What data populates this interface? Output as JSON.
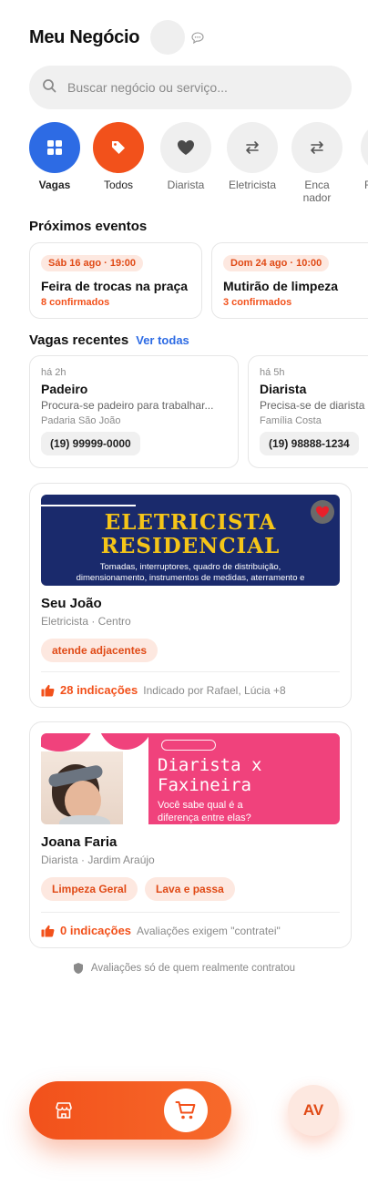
{
  "header": {
    "title": "Meu Negócio"
  },
  "search": {
    "placeholder": "Buscar negócio ou serviço..."
  },
  "categories": [
    {
      "label": "Vagas",
      "icon": "grid-icon"
    },
    {
      "label": "Todos",
      "icon": "tag-icon"
    },
    {
      "label": "Diarista",
      "icon": "heart-icon"
    },
    {
      "label": "Eletricista",
      "icon": "swap-icon"
    },
    {
      "label": "Encanador",
      "icon": "swap-icon"
    },
    {
      "label": "F",
      "icon": "swap-icon"
    }
  ],
  "events": {
    "title": "Próximos eventos",
    "items": [
      {
        "date": "Sáb 16 ago · 19:00",
        "name": "Feira de trocas na praça",
        "count": "8 confirmados"
      },
      {
        "date": "Dom 24 ago · 10:00",
        "name": "Mutirão de limpeza",
        "count": "3 confirmados"
      }
    ]
  },
  "jobs": {
    "title": "Vagas recentes",
    "see_all": "Ver todas",
    "items": [
      {
        "time": "há 2h",
        "title": "Padeiro",
        "desc": "Procura-se padeiro para trabalhar...",
        "place": "Padaria São João",
        "phone": "(19) 99999-0000"
      },
      {
        "time": "há 5h",
        "title": "Diarista",
        "desc": "Precisa-se de diarista",
        "place": "Família Costa",
        "phone": "(19) 98888-1234"
      }
    ]
  },
  "providers": [
    {
      "banner": {
        "line1": "ELETRICISTA",
        "line2": "RESIDENCIAL",
        "sub1": "Tomadas, interruptores, quadro de distribuição,",
        "sub2": "dimensionamento, instrumentos de medidas, aterramento e"
      },
      "name": "Seu João",
      "sub": "Eletricista · Centro",
      "tags": [
        "atende adjacentes"
      ],
      "rec_count": "28 indicações",
      "rec_note": "Indicado por Rafael, Lúcia +8"
    },
    {
      "banner": {
        "line1": "Diarista x",
        "line2": "Faxineira",
        "sub1": "Você sabe qual é a",
        "sub2": "diferença entre elas?"
      },
      "name": "Joana Faria",
      "sub": "Diarista · Jardim Araújo",
      "tags": [
        "Limpeza Geral",
        "Lava e passa"
      ],
      "rec_count": "0 indicações",
      "rec_note": "Avaliações exigem \"contratei\""
    }
  ],
  "footer_note": "Avaliações só de quem realmente contratou",
  "bottom": {
    "avatar": "AV"
  },
  "colors": {
    "accent": "#f2511b",
    "blue": "#2d6be4",
    "tag_bg": "#fde8e0"
  }
}
